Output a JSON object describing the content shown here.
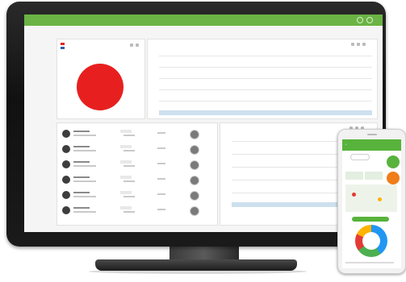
{
  "colors": {
    "brand_green": "#6ab344",
    "pie_red": "#e7201f",
    "legend_blue": "#2f5fa8",
    "fab_orange": "#f07d1a",
    "bar_blue": "#cde0ee",
    "bezel": "#151515"
  },
  "nav": {
    "logo": "",
    "links": [
      "",
      "",
      "",
      "",
      "",
      ""
    ],
    "user": ""
  },
  "presence": {
    "title": "",
    "subtitle": "",
    "legend": [
      "",
      ""
    ],
    "pie_label": ""
  },
  "attendance": {
    "title": "",
    "filter": "",
    "y_ticks": [
      "",
      "",
      "",
      "",
      ""
    ]
  },
  "events": {
    "rows": [
      {
        "name": "",
        "detail": "",
        "time": "",
        "status": ""
      },
      {
        "name": "",
        "detail": "",
        "time": "",
        "status": ""
      },
      {
        "name": "",
        "detail": "",
        "time": "",
        "status": ""
      },
      {
        "name": "",
        "detail": "",
        "time": "",
        "status": ""
      },
      {
        "name": "",
        "detail": "",
        "time": "",
        "status": ""
      },
      {
        "name": "",
        "detail": "",
        "time": "",
        "status": ""
      }
    ]
  },
  "realtime": {
    "title": "",
    "filter": "",
    "y_ticks": [
      "",
      "",
      "",
      "",
      ""
    ]
  },
  "phone": {
    "title": "",
    "greeting": "",
    "menu": [
      "",
      ""
    ],
    "stat_label": ""
  },
  "icons": {
    "menu": "hamburger-icon",
    "settings": "gear-icon",
    "notifications": "bell-icon",
    "refresh": "refresh-icon",
    "add": "plus-icon",
    "location": "map-pin-icon",
    "user": "user-icon"
  }
}
